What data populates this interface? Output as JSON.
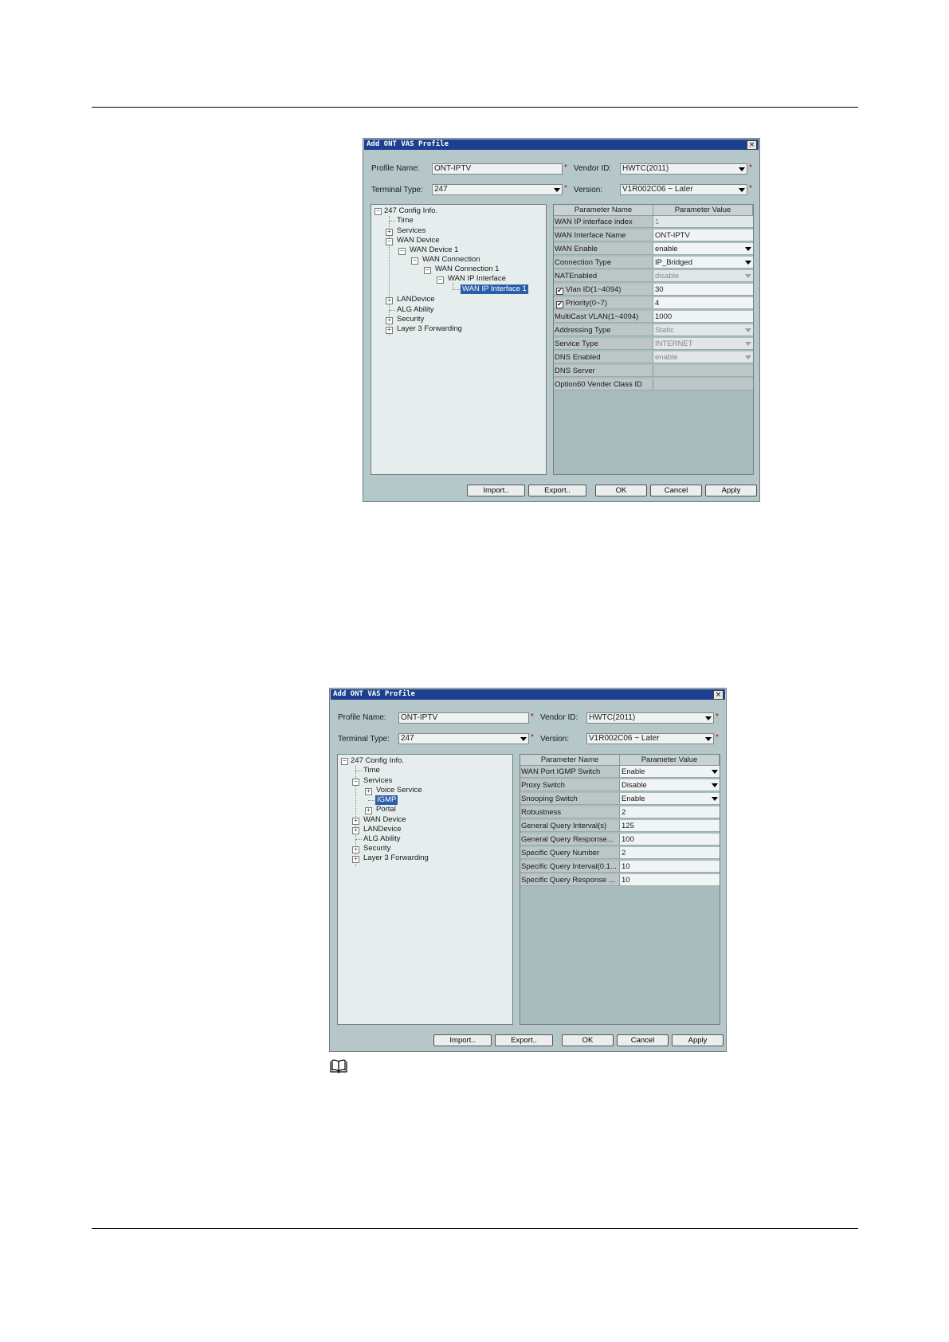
{
  "dialog1": {
    "title": "Add ONT VAS Profile",
    "close": "×",
    "profile_name_label": "Profile Name:",
    "profile_name_value": "ONT-IPTV",
    "vendor_id_label": "Vendor ID:",
    "vendor_id_value": "HWTC(2011)",
    "terminal_type_label": "Terminal Type:",
    "terminal_type_value": "247",
    "version_label": "Version:",
    "version_value": "V1R002C06 ~ Later",
    "required_mark": "*",
    "tree": {
      "root": "247 Config Info.",
      "time": "Time",
      "services": "Services",
      "wan_device": "WAN Device",
      "wan_device_1": "WAN Device 1",
      "wan_connection": "WAN Connection",
      "wan_connection_1": "WAN Connection 1",
      "wan_ip_interface": "WAN IP Interface",
      "wan_ip_interface_1": "WAN IP Interface 1",
      "lan_device": "LANDevice",
      "alg_ability": "ALG Ability",
      "security": "Security",
      "layer3": "Layer 3 Forwarding"
    },
    "table_header": {
      "name": "Parameter Name",
      "value": "Parameter Value"
    },
    "rows": [
      {
        "name": "WAN IP interface index",
        "value": "1"
      },
      {
        "name": "WAN Interface Name",
        "value": "ONT-IPTV"
      },
      {
        "name": "WAN Enable",
        "value": "enable"
      },
      {
        "name": "Connection Type",
        "value": "IP_Bridged"
      },
      {
        "name": "NATEnabled",
        "value": "disable"
      },
      {
        "name": "Vlan ID(1~4094)",
        "value": "30"
      },
      {
        "name": "Priority(0~7)",
        "value": "4"
      },
      {
        "name": "MultiCast VLAN(1~4094)",
        "value": "1000"
      },
      {
        "name": "Addressing Type",
        "value": "Static"
      },
      {
        "name": "Service Type",
        "value": "INTERNET"
      },
      {
        "name": "DNS Enabled",
        "value": "enable"
      },
      {
        "name": "DNS Server",
        "value": ""
      },
      {
        "name": "Option60 Vender Class ID",
        "value": ""
      }
    ],
    "buttons": {
      "import": "Import..",
      "export": "Export..",
      "ok": "OK",
      "cancel": "Cancel",
      "apply": "Apply"
    }
  },
  "dialog2": {
    "title": "Add ONT VAS Profile",
    "close": "×",
    "profile_name_label": "Profile Name:",
    "profile_name_value": "ONT-IPTV",
    "vendor_id_label": "Vendor ID:",
    "vendor_id_value": "HWTC(2011)",
    "terminal_type_label": "Terminal Type:",
    "terminal_type_value": "247",
    "version_label": "Version:",
    "version_value": "V1R002C06 ~ Later",
    "required_mark": "*",
    "tree": {
      "root": "247 Config Info.",
      "time": "Time",
      "services": "Services",
      "voice_service": "Voice Service",
      "igmp": "IGMP",
      "portal": "Portal",
      "wan_device": "WAN Device",
      "lan_device": "LANDevice",
      "alg_ability": "ALG Ability",
      "security": "Security",
      "layer3": "Layer 3 Forwarding"
    },
    "table_header": {
      "name": "Parameter Name",
      "value": "Parameter Value"
    },
    "rows": [
      {
        "name": "WAN Port IGMP Switch",
        "value": "Enable"
      },
      {
        "name": "Proxy Switch",
        "value": "Disable"
      },
      {
        "name": "Snooping Switch",
        "value": "Enable"
      },
      {
        "name": "Robustness",
        "value": "2"
      },
      {
        "name": "General Query Interval(s)",
        "value": "125"
      },
      {
        "name": "General Query Response...",
        "value": "100"
      },
      {
        "name": "Specific Query Number",
        "value": "2"
      },
      {
        "name": "Specific Query Interval(0.1...",
        "value": "10"
      },
      {
        "name": "Specific Query Response ...",
        "value": "10"
      }
    ],
    "buttons": {
      "import": "Import..",
      "export": "Export..",
      "ok": "OK",
      "cancel": "Cancel",
      "apply": "Apply"
    }
  },
  "note_icon": "book-icon"
}
